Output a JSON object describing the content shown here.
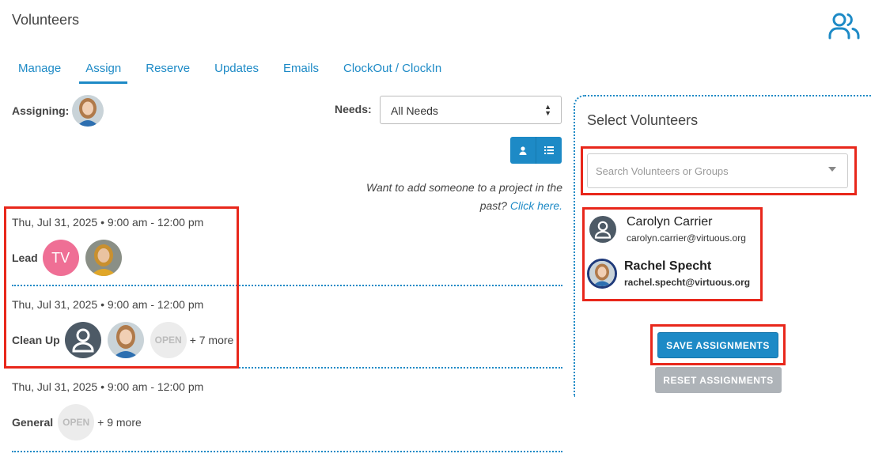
{
  "header": {
    "title": "Volunteers",
    "icon": "users-icon"
  },
  "tabs": [
    {
      "label": "Manage"
    },
    {
      "label": "Assign",
      "active": true
    },
    {
      "label": "Reserve"
    },
    {
      "label": "Updates"
    },
    {
      "label": "Emails"
    },
    {
      "label": "ClockOut / ClockIn"
    }
  ],
  "assigning": {
    "label": "Assigning:"
  },
  "needs": {
    "label": "Needs:",
    "selected": "All Needs"
  },
  "past_note": {
    "text": "Want to add someone to a project in the past?",
    "link": "Click here."
  },
  "shifts": [
    {
      "time": "Thu, Jul 31, 2025 • 9:00 am - 12:00 pm",
      "role": "Lead",
      "initials": "TV"
    },
    {
      "time": "Thu, Jul 31, 2025 • 9:00 am - 12:00 pm",
      "role": "Clean Up",
      "open": "OPEN",
      "more": "+ 7 more"
    },
    {
      "time": "Thu, Jul 31, 2025 • 9:00 am - 12:00 pm",
      "role": "General",
      "open": "OPEN",
      "more": "+ 9 more"
    }
  ],
  "panel": {
    "title": "Select Volunteers",
    "search_placeholder": "Search Volunteers or Groups",
    "volunteers": [
      {
        "name": "Carolyn Carrier",
        "email": "carolyn.carrier@virtuous.org"
      },
      {
        "name": "Rachel Specht",
        "email": "rachel.specht@virtuous.org"
      }
    ],
    "save_label": "SAVE ASSIGNMENTS",
    "reset_label": "RESET ASSIGNMENTS"
  },
  "colors": {
    "accent": "#1d8ac6",
    "highlight": "#e8271b",
    "initials_avatar": "#ef6f95"
  }
}
